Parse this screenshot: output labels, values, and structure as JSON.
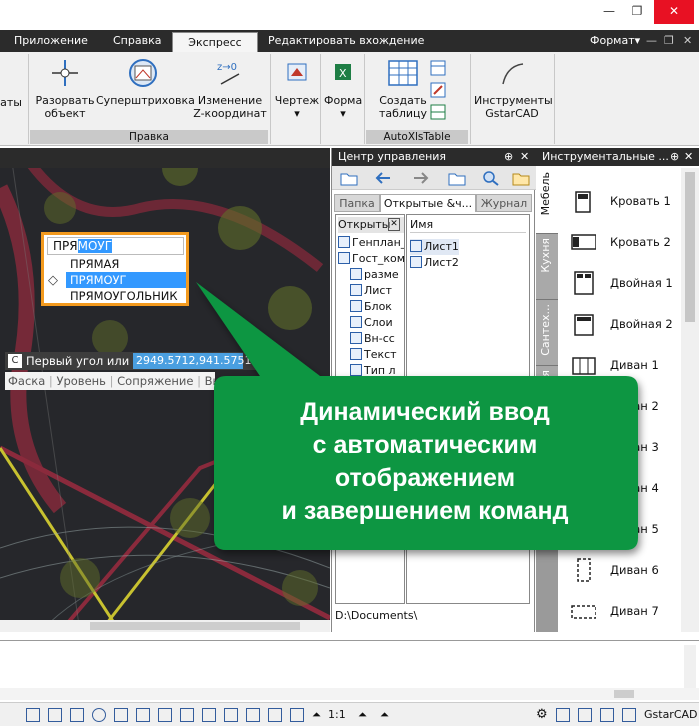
{
  "window": {
    "minimize": "—",
    "restore": "❐",
    "close": "✕"
  },
  "ribbon": {
    "tabs": [
      "Приложение",
      "Справка",
      "Экспресс",
      "Редактировать вхождение"
    ],
    "format_menu": "Формат",
    "left_partial_label": "аты",
    "buttons": {
      "explode": "Разорвать объект",
      "superhatch": "Суперштриховка",
      "change_z": "Изменение Z-координат",
      "drawing": "Чертеж",
      "forms": "Форма",
      "create_table": "Создать таблицу",
      "tools": "Инструменты GstarCAD"
    },
    "groups": {
      "edit": "Правка",
      "autoxls": "AutoXlsTable"
    }
  },
  "dynamic_input": {
    "typed": "ПРЯ",
    "highlight": "МОУГ",
    "options": [
      "ПРЯМАЯ",
      "ПРЯМОУГ",
      "ПРЯМОУГОЛЬНИК"
    ],
    "selected_index": 1
  },
  "command": {
    "prompt": "Первый угол или",
    "value": "2949.5712,941.5751",
    "options": [
      "Фаска",
      "Уровень",
      "Сопряжение",
      "Высо"
    ]
  },
  "design_center": {
    "title": "Центр управления",
    "tabs": [
      "Папка",
      "Открытые &ч...",
      "Журнал"
    ],
    "tree_header": "Открыты",
    "tree_items": [
      "Генплан_",
      "Гост_ком",
      "разме",
      "Лист",
      "Блок",
      "Слои",
      "Вн-сс",
      "Текст",
      "Тип л"
    ],
    "list_header": "Имя",
    "list_items": [
      "Лист1",
      "Лист2"
    ],
    "path": "D:\\Documents\\"
  },
  "tool_palettes": {
    "title": "Инструментальные ...",
    "side_tabs": [
      "Мебель",
      "Кухня",
      "Сантех...",
      "ения"
    ],
    "items": [
      "Кровать 1",
      "Кровать 2",
      "Двойная 1",
      "Двойная 2",
      "Диван 1",
      "Диван 2",
      "Диван 3",
      "Диван 4",
      "Диван 5",
      "Диван 6",
      "Диван 7"
    ]
  },
  "status_bar": {
    "scale": "1:1",
    "app_name": "GstarCAD"
  },
  "callout": {
    "lines": [
      "Динамический ввод",
      "с автоматическим",
      "отображением",
      "и завершением команд"
    ],
    "color": "#0c9642"
  }
}
